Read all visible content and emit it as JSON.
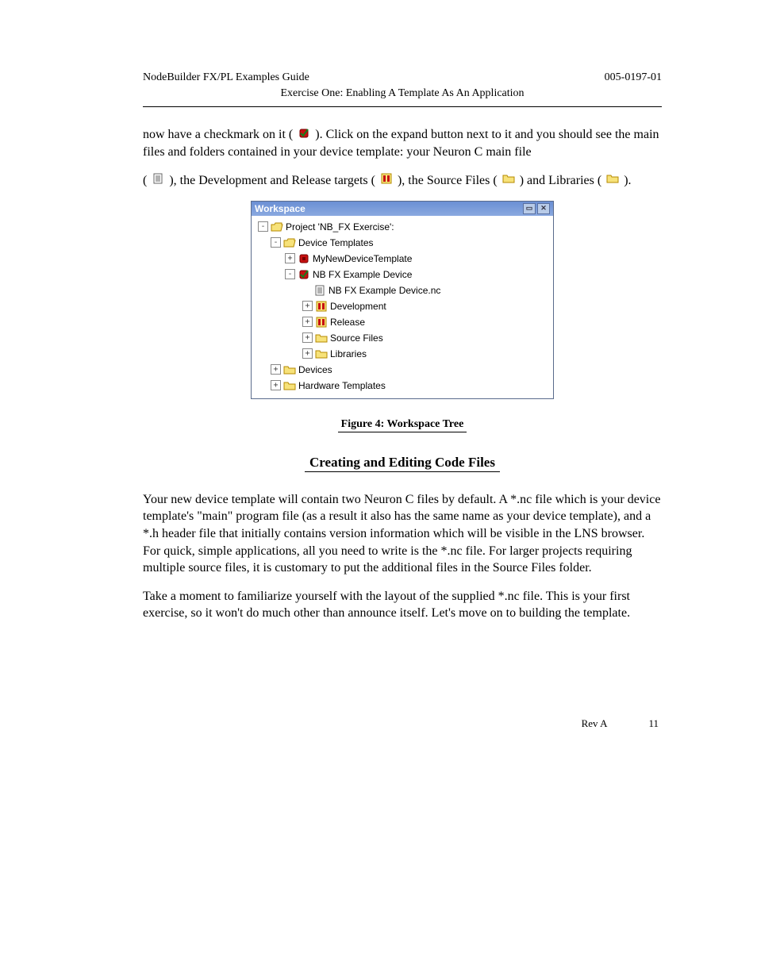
{
  "header": {
    "product": "NodeBuilder FX/PL Examples Guide",
    "doc_number": "005-0197-01",
    "section_title": "Exercise One: Enabling A Template As An Application",
    "rev": "Rev A",
    "page": "11"
  },
  "para1_prefix": "now have a checkmark on it (",
  "para1_suffix": "). Click on the expand button next to it and you should see the main files and folders contained in your device template: your Neuron C main file",
  "para2_prefix": "(",
  "para2_mid1": "), the Development and Release targets (",
  "para2_mid2": "), the Source Files (",
  "para2_suffix": ") and Libraries (",
  "para2_end": ").",
  "figure_caption": "Figure 4: Workspace Tree",
  "section_heading": "Creating and Editing Code Files",
  "para_code1": "Your new device template will contain two Neuron C files by default. A *.nc file which is your device template's \"main\" program file (as a result it also has the same name as your device template), and a *.h header file that initially contains version information which will be visible in the LNS browser. For quick, simple applications, all you need to write is the *.nc file. For larger projects requiring multiple source files, it is customary to put the additional files in the Source Files folder.",
  "para_code2": "Take a moment to familiarize yourself with the layout of the supplied *.nc file. This is your first exercise, so it won't do much other than announce itself. Let's move on to building the template.",
  "tree": {
    "title": "Workspace",
    "items": [
      {
        "level": 0,
        "exp": "-",
        "icon": "folder-open",
        "label": "Project 'NB_FX Exercise':"
      },
      {
        "level": 1,
        "exp": "-",
        "icon": "folder-open",
        "label": "Device Templates"
      },
      {
        "level": 2,
        "exp": "+",
        "icon": "chip-red",
        "label": "MyNewDeviceTemplate"
      },
      {
        "level": 2,
        "exp": "-",
        "icon": "chip-check",
        "label": "NB FX Example Device"
      },
      {
        "level": 3,
        "exp": "",
        "icon": "doc",
        "label": "NB FX Example Device.nc"
      },
      {
        "level": 3,
        "exp": "+",
        "icon": "target",
        "label": "Development"
      },
      {
        "level": 3,
        "exp": "+",
        "icon": "target",
        "label": "Release"
      },
      {
        "level": 3,
        "exp": "+",
        "icon": "folder",
        "label": "Source Files"
      },
      {
        "level": 3,
        "exp": "+",
        "icon": "folder",
        "label": "Libraries"
      },
      {
        "level": 1,
        "exp": "+",
        "icon": "folder",
        "label": "Devices"
      },
      {
        "level": 1,
        "exp": "+",
        "icon": "folder",
        "label": "Hardware Templates"
      }
    ]
  }
}
